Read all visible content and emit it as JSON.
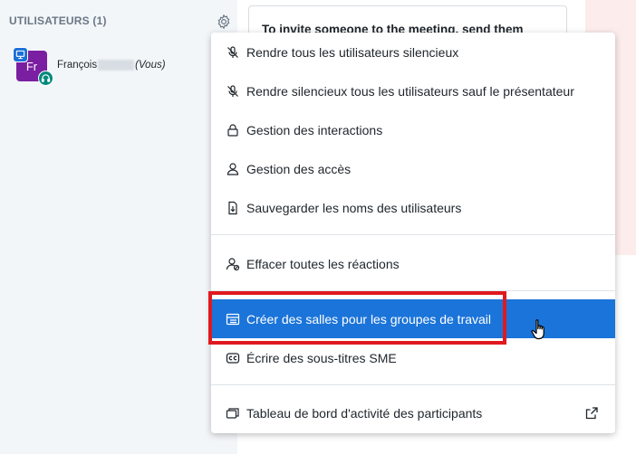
{
  "users_panel": {
    "title": "UTILISATEURS (1)",
    "user": {
      "initials": "Fr",
      "name_start": "François",
      "you_label": "(Vous)",
      "avatar_color": "#7b1fa2",
      "presenter_color": "#1b6fd8",
      "audio_color": "#00897b"
    }
  },
  "invite": {
    "text": "To invite someone to the meeting, send them"
  },
  "menu": {
    "items": [
      {
        "label": "Rendre tous les utilisateurs silencieux",
        "icon": "mute-icon"
      },
      {
        "label": "Rendre silencieux tous les utilisateurs sauf le présentateur",
        "icon": "mute-icon"
      },
      {
        "label": "Gestion des interactions",
        "icon": "lock-icon"
      },
      {
        "label": "Gestion des accès",
        "icon": "user-icon"
      },
      {
        "label": "Sauvegarder les noms des utilisateurs",
        "icon": "download-icon"
      },
      {
        "label": "Effacer toutes les réactions",
        "icon": "user-clear-icon"
      },
      {
        "label": "Créer des salles pour les groupes de travail",
        "icon": "rooms-icon",
        "active": true
      },
      {
        "label": "Écrire des sous-titres SME",
        "icon": "closed-captions-icon"
      },
      {
        "label": "Tableau de bord d'activité des participants",
        "icon": "dashboard-icon"
      }
    ],
    "active_color": "#1b74d9",
    "highlight_color": "#e0191f"
  }
}
